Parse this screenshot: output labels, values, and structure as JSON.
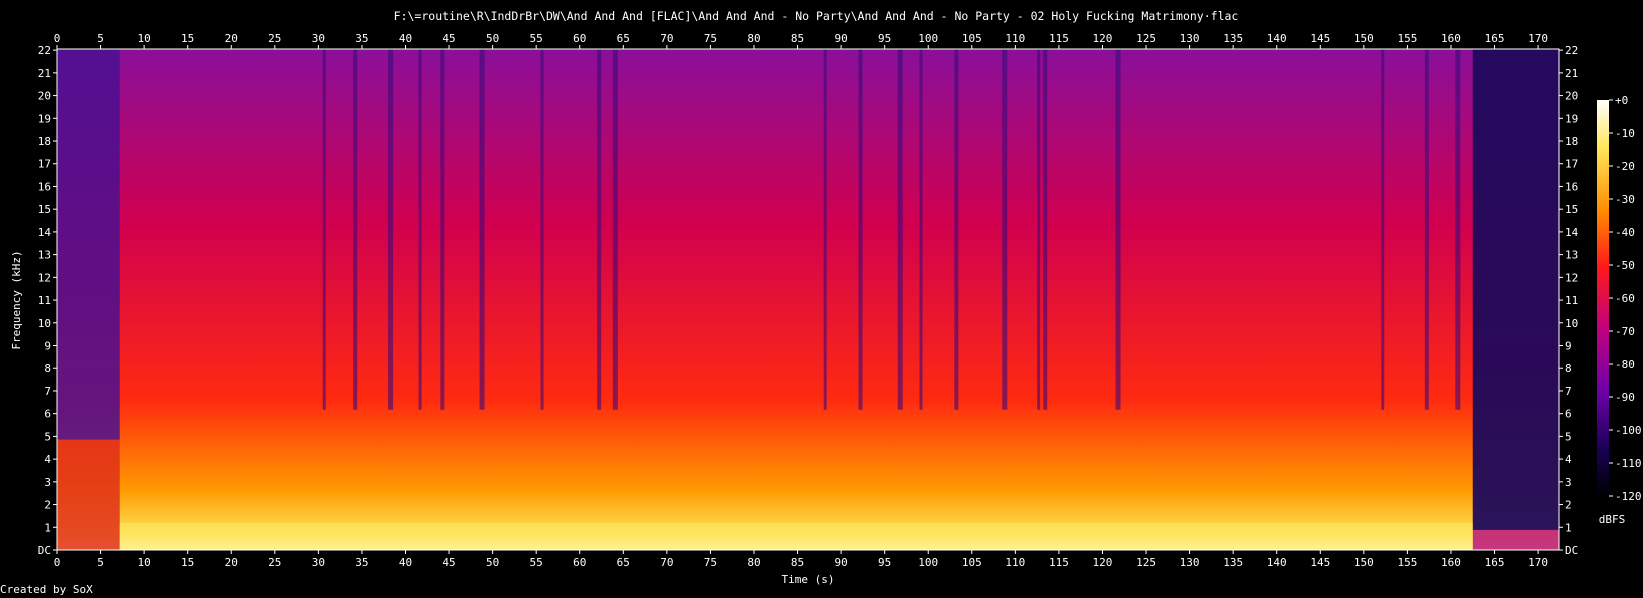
{
  "chart_data": {
    "type": "heatmap",
    "title": "F:\\=routine\\R\\IndDrBr\\DW\\And And And [FLAC]\\And And And - No Party\\And And And - No Party - 02 Holy Fucking Matrimony·flac",
    "xlabel": "Time (s)",
    "ylabel": "Frequency (kHz)",
    "x_ticks": [
      "0",
      "5",
      "10",
      "15",
      "20",
      "25",
      "30",
      "35",
      "40",
      "45",
      "50",
      "55",
      "60",
      "65",
      "70",
      "75",
      "80",
      "85",
      "90",
      "95",
      "100",
      "105",
      "110",
      "115",
      "120",
      "125",
      "130",
      "135",
      "140",
      "145",
      "150",
      "155",
      "160",
      "165",
      "170"
    ],
    "y_ticks": [
      "DC",
      "1",
      "2",
      "3",
      "4",
      "5",
      "6",
      "7",
      "8",
      "9",
      "10",
      "11",
      "12",
      "13",
      "14",
      "15",
      "16",
      "17",
      "18",
      "19",
      "20",
      "21",
      "22"
    ],
    "xlim": [
      0,
      172.4
    ],
    "ylim": [
      0,
      22.05
    ],
    "colorbar": {
      "label": "dBFS",
      "ticks": [
        "+0",
        "-10",
        "-20",
        "-30",
        "-40",
        "-50",
        "-60",
        "-70",
        "-80",
        "-90",
        "-100",
        "-110",
        "-120"
      ],
      "range": [
        -120,
        0
      ]
    },
    "colors": [
      "#000000",
      "#1b0055",
      "#6a00a8",
      "#c0007f",
      "#ff1a1a",
      "#ff8c00",
      "#ffea3d",
      "#ffffff"
    ]
  },
  "footer": {
    "credit": "Created by SoX"
  }
}
